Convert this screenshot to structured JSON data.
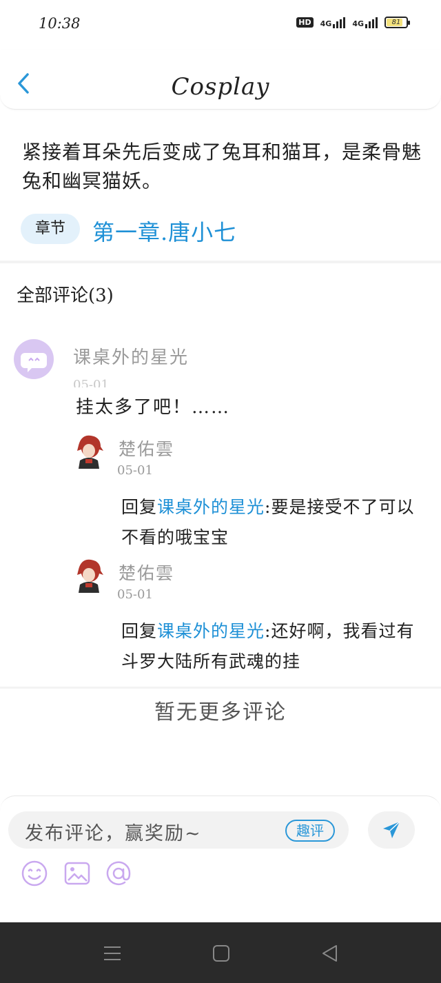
{
  "status_bar": {
    "time": "10:38",
    "hd_label": "HD",
    "network1": "4G",
    "network2": "4G",
    "battery": "81",
    "battery_level": 0.81
  },
  "header": {
    "title": "Cosplay",
    "back_icon": "chevron-left-icon"
  },
  "excerpt": {
    "text": "紧接着耳朵先后变成了兔耳和猫耳，是柔骨魅兔和幽冥猫妖。"
  },
  "chapter": {
    "badge": "章节",
    "title": "第一章.唐小七"
  },
  "comments": {
    "heading": "全部评论(3)",
    "items": [
      {
        "username": "课桌外的星光",
        "date": "05-01",
        "content": "挂太多了吧！……",
        "replies": [
          {
            "username": "楚佑雲",
            "date": "05-01",
            "prefix": "回复",
            "mention": "课桌外的星光",
            "text": ":要是接受不了可以不看的哦宝宝"
          },
          {
            "username": "楚佑雲",
            "date": "05-01",
            "prefix": "回复",
            "mention": "课桌外的星光",
            "text": ":还好啊，我看过有斗罗大陆所有武魂的挂"
          }
        ]
      }
    ],
    "no_more": "暂无更多评论"
  },
  "composer": {
    "placeholder": "发布评论，赢奖励~",
    "quping_label": "趣评",
    "send_icon": "send-icon",
    "tools": [
      "emoji-icon",
      "image-icon",
      "at-icon"
    ]
  },
  "colors": {
    "accent": "#1e90d6",
    "tool": "#c9a8ef",
    "badge_bg": "#e3f1fb"
  }
}
